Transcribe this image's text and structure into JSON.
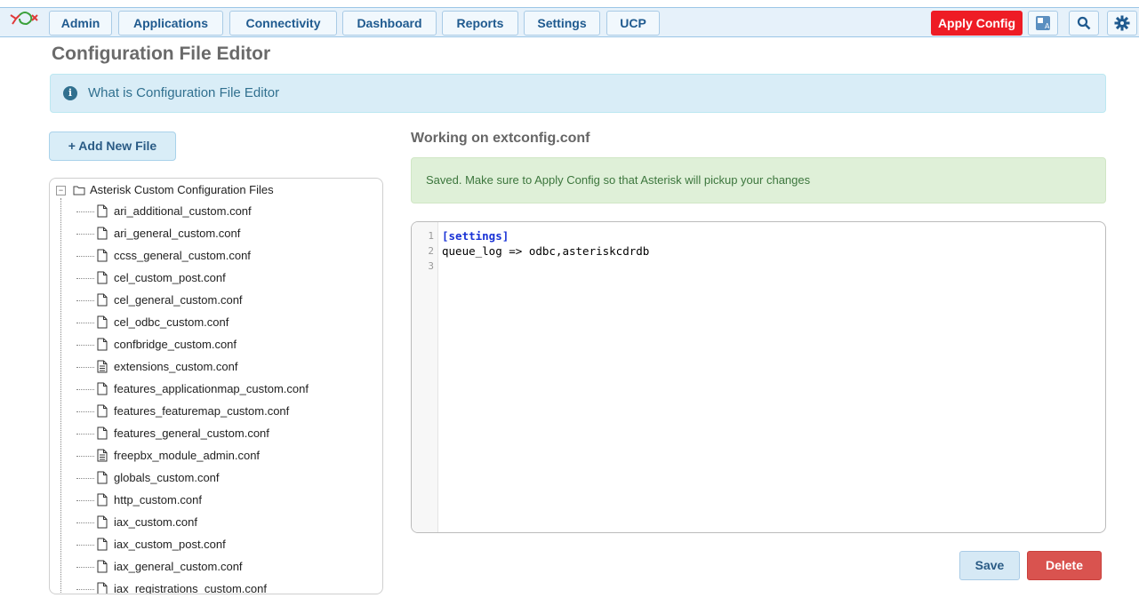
{
  "nav": {
    "items": [
      {
        "label": "Admin"
      },
      {
        "label": "Applications"
      },
      {
        "label": "Connectivity"
      },
      {
        "label": "Dashboard"
      },
      {
        "label": "Reports"
      },
      {
        "label": "Settings"
      },
      {
        "label": "UCP"
      }
    ],
    "apply_label": "Apply Config",
    "icons": [
      "language-icon",
      "search-icon",
      "gear-icon"
    ]
  },
  "page": {
    "title": "Configuration File Editor",
    "info_text": "What is Configuration File Editor",
    "add_button": "+ Add New File"
  },
  "tree": {
    "root_label": "Asterisk Custom Configuration Files",
    "files": [
      {
        "name": "ari_additional_custom.conf",
        "has_content": false
      },
      {
        "name": "ari_general_custom.conf",
        "has_content": false
      },
      {
        "name": "ccss_general_custom.conf",
        "has_content": false
      },
      {
        "name": "cel_custom_post.conf",
        "has_content": false
      },
      {
        "name": "cel_general_custom.conf",
        "has_content": false
      },
      {
        "name": "cel_odbc_custom.conf",
        "has_content": false
      },
      {
        "name": "confbridge_custom.conf",
        "has_content": false
      },
      {
        "name": "extensions_custom.conf",
        "has_content": true
      },
      {
        "name": "features_applicationmap_custom.conf",
        "has_content": false
      },
      {
        "name": "features_featuremap_custom.conf",
        "has_content": false
      },
      {
        "name": "features_general_custom.conf",
        "has_content": false
      },
      {
        "name": "freepbx_module_admin.conf",
        "has_content": true
      },
      {
        "name": "globals_custom.conf",
        "has_content": false
      },
      {
        "name": "http_custom.conf",
        "has_content": false
      },
      {
        "name": "iax_custom.conf",
        "has_content": false
      },
      {
        "name": "iax_custom_post.conf",
        "has_content": false
      },
      {
        "name": "iax_general_custom.conf",
        "has_content": false
      },
      {
        "name": "iax_registrations_custom.conf",
        "has_content": false
      }
    ]
  },
  "editor": {
    "working_on": "Working on extconfig.conf",
    "saved_message": "Saved. Make sure to Apply Config so that Asterisk will pickup your changes",
    "lines": [
      {
        "num": "1",
        "text": "[settings]",
        "kind": "section"
      },
      {
        "num": "2",
        "text": "queue_log => odbc,asteriskcdrdb",
        "kind": "plain"
      },
      {
        "num": "3",
        "text": "",
        "kind": "plain"
      }
    ],
    "save_label": "Save",
    "delete_label": "Delete"
  },
  "colors": {
    "apply_bg": "#ee1c25",
    "delete_bg": "#d9534f",
    "nav_text": "#1f5a8f",
    "section_code": "#1a33d6"
  }
}
